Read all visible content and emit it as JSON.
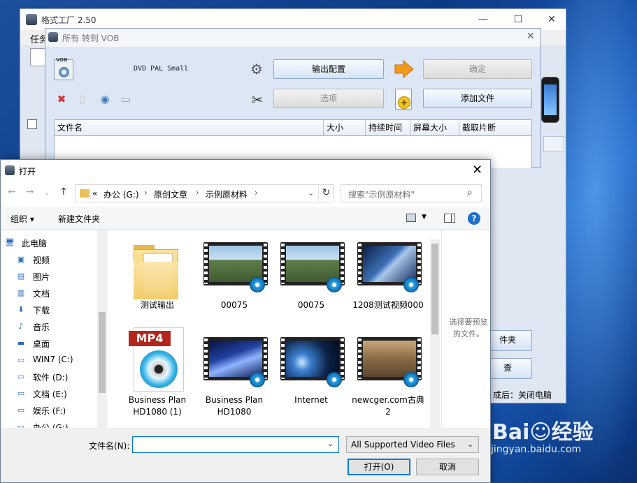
{
  "main_window": {
    "title": "格式工厂 2.50",
    "menu_first": "任务",
    "status_text": "成后：关闭电脑",
    "side_button_1": "件夹",
    "side_button_2": "查"
  },
  "vob_window": {
    "title": "所有 转到 VOB",
    "logo_label": "VOB",
    "profile": "DVD PAL Small",
    "output_config_button": "输出配置",
    "ok_button": "确定",
    "options_button": "选项",
    "add_file_button": "添加文件",
    "columns": [
      "文件名",
      "大小",
      "持续时间",
      "屏幕大小",
      "截取片断"
    ]
  },
  "open_dialog": {
    "title": "打开",
    "breadcrumb": [
      "«",
      "办公 (G:)",
      "原创文章",
      "示例原材料"
    ],
    "search_placeholder": "搜索\"示例原材料\"",
    "organize": "组织 ▾",
    "new_folder": "新建文件夹",
    "tree": [
      {
        "icon": "pc-icon",
        "glyph": "🖥",
        "label": "此电脑"
      },
      {
        "icon": "video-icon",
        "glyph": "▣",
        "label": "视频"
      },
      {
        "icon": "pictures-icon",
        "glyph": "▤",
        "label": "图片"
      },
      {
        "icon": "documents-icon",
        "glyph": "▥",
        "label": "文档"
      },
      {
        "icon": "downloads-icon",
        "glyph": "⬇",
        "label": "下载"
      },
      {
        "icon": "music-icon",
        "glyph": "♪",
        "label": "音乐"
      },
      {
        "icon": "desktop-icon",
        "glyph": "▬",
        "label": "桌面"
      },
      {
        "icon": "drive-icon",
        "glyph": "▭",
        "label": "WIN7 (C:)"
      },
      {
        "icon": "drive-icon",
        "glyph": "▭",
        "label": "软件 (D:)"
      },
      {
        "icon": "drive-icon",
        "glyph": "▭",
        "label": "文档 (E:)"
      },
      {
        "icon": "drive-icon",
        "glyph": "▭",
        "label": "娱乐 (F:)"
      },
      {
        "icon": "drive-icon",
        "glyph": "▭",
        "label": "办公 (G:)"
      }
    ],
    "files": [
      {
        "name": "测试输出",
        "kind": "folder"
      },
      {
        "name": "00075",
        "kind": "video",
        "scene": "windmill"
      },
      {
        "name": "00075",
        "kind": "video",
        "scene": "windmill"
      },
      {
        "name": "1208测试视频000",
        "kind": "video",
        "scene": "blue-glass"
      },
      {
        "name": "Business Plan HD1080 (1)",
        "kind": "mp4"
      },
      {
        "name": "Business Plan HD1080",
        "kind": "video",
        "scene": "blue-light"
      },
      {
        "name": "Internet",
        "kind": "video",
        "scene": "earth"
      },
      {
        "name": "newcger.com古典2",
        "kind": "video",
        "scene": "sepia"
      }
    ],
    "mp4_label": "MP4",
    "preview_text": "选择要预览的文件。",
    "filename_label": "文件名(N):",
    "filename_value": "",
    "filetype_value": "All Supported Video Files",
    "open_button": "打开(O)",
    "cancel_button": "取消"
  },
  "watermark": {
    "brand": "Bai☺经验",
    "url": "jingyan.baidu.com"
  }
}
